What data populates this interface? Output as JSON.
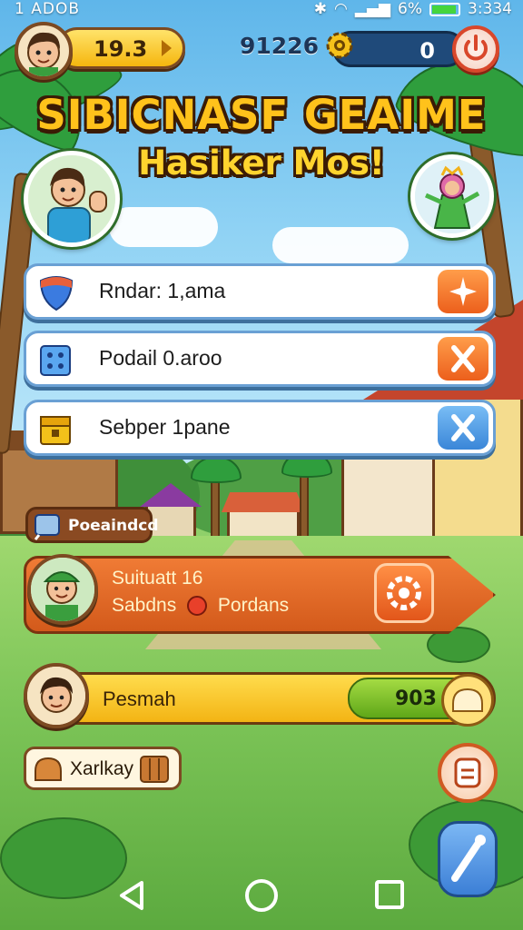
{
  "status_bar": {
    "left_text": "1 ADOB",
    "right_text": "6%",
    "time": "3:334",
    "battery_level": 0.85
  },
  "top_bar": {
    "coins": "19.3",
    "score": "91226",
    "gems": "0"
  },
  "title": {
    "line1": "SIBICNASF GEAIME",
    "line2": "Hasiker Mos!"
  },
  "menu_rows": [
    {
      "label": "Rndar: 1,ama",
      "icon": "shield-icon",
      "action_icon": "sparkle-icon",
      "action_color": "#ec5f1c"
    },
    {
      "label": "Podail 0.aroo",
      "icon": "cube-icon",
      "action_icon": "close-icon",
      "action_color": "#ec5f1c"
    },
    {
      "label": "Sebper 1pane",
      "icon": "box-icon",
      "action_icon": "close-icon",
      "action_color": "#3a86d8"
    }
  ],
  "small_tag": {
    "label": "Poeaindcd"
  },
  "banner": {
    "line1": "Suituatt 16",
    "line2_a": "Sabdns",
    "line2_b": "Pordans"
  },
  "player_bar": {
    "name": "Pesmah",
    "value": "903"
  },
  "bottom_tag": {
    "label": "Xarlkay"
  },
  "colors": {
    "accent_orange": "#ec5f1c",
    "accent_blue": "#3a86d8",
    "title_yellow": "#ffc21b",
    "coin_yellow": "#f5b60e"
  }
}
